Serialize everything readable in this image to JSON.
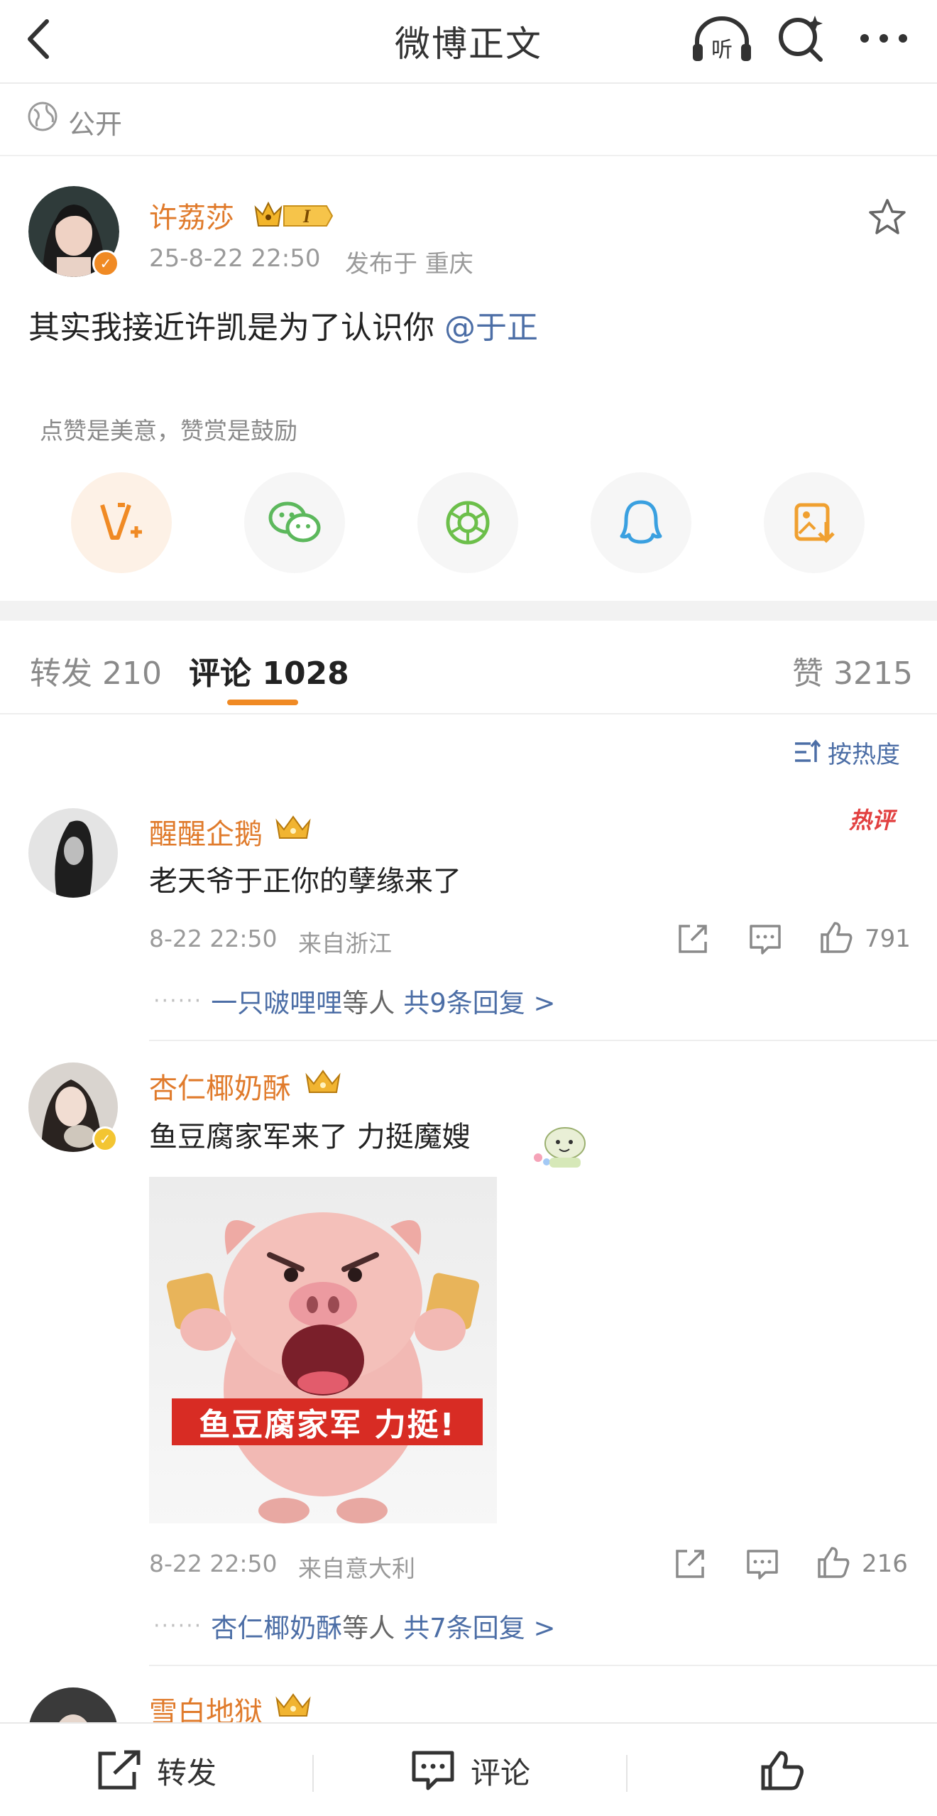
{
  "header": {
    "title": "微博正文",
    "listen_label": "听"
  },
  "visibility": {
    "label": "公开"
  },
  "post": {
    "author": "许荔莎",
    "level_badge": "I",
    "timestamp": "25-8-22 22:50",
    "location": "发布于 重庆",
    "text": "其实我接近许凯是为了认识你 ",
    "mention": "@于正",
    "reward_hint": "点赞是美意，赞赏是鼓励"
  },
  "tabs": {
    "repost_label": "转发",
    "repost_count": "210",
    "comment_label": "评论",
    "comment_count": "1028",
    "like_label": "赞",
    "like_count": "3215"
  },
  "sort": {
    "label": "按热度"
  },
  "comments": [
    {
      "user": "醒醒企鹅",
      "hot_badge": "热评",
      "text": "老天爷于正你的孽缘来了",
      "time": "8-22 22:50",
      "location": "来自浙江",
      "likes": "791",
      "reply_users": "一只啵哩哩",
      "reply_suffix": "等人",
      "reply_count_text": "共9条回复 >"
    },
    {
      "user": "杏仁椰奶酥",
      "text": "鱼豆腐家军来了 力挺魔嫂",
      "image_caption": "鱼豆腐家军 力挺!",
      "time": "8-22 22:50",
      "location": "来自意大利",
      "likes": "216",
      "reply_users": "杏仁椰奶酥",
      "reply_suffix": "等人",
      "reply_count_text": "共7条回复 >"
    },
    {
      "user": "雪白地狱"
    }
  ],
  "bottom_bar": {
    "repost": "转发",
    "comment": "评论"
  },
  "colors": {
    "accent_orange": "#f08a24",
    "username_orange": "#e07b2c",
    "link_blue": "#4c6ea6",
    "hot_red": "#e24040"
  }
}
